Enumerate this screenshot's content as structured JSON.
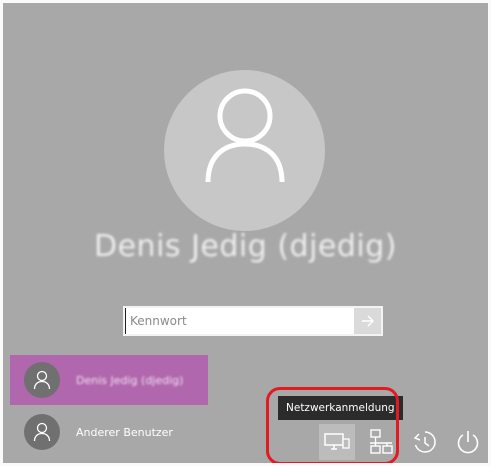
{
  "user": {
    "display_name": "Denis Jedig (djedig)"
  },
  "password": {
    "placeholder": "Kennwort",
    "value": ""
  },
  "user_list": [
    {
      "label": "Denis Jedig (djedig)",
      "selected": true
    },
    {
      "label": "Anderer Benutzer",
      "selected": false
    }
  ],
  "tooltip": {
    "text": "Netzwerkanmeldung"
  },
  "tray": [
    {
      "icon": "network-sign-in-icon",
      "hovered": true
    },
    {
      "icon": "network-icon",
      "hovered": false
    },
    {
      "icon": "ease-of-access-icon",
      "hovered": false
    },
    {
      "icon": "power-icon",
      "hovered": false
    }
  ],
  "colors": {
    "background": "#a8a8a8",
    "selected_user_tile": "#b067ad",
    "tooltip_bg": "#2b2b2b",
    "highlight_ring": "#e11b22"
  }
}
